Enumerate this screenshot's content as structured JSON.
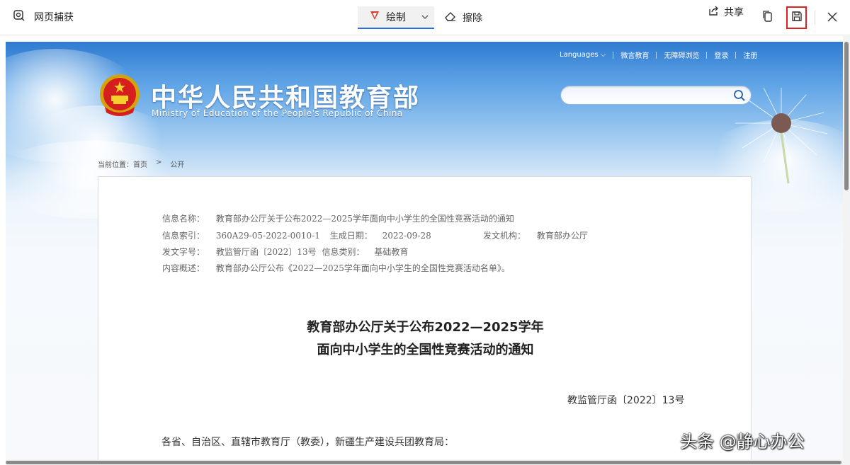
{
  "toolbar": {
    "app_label": "网页捕获",
    "draw_label": "绘制",
    "erase_label": "擦除",
    "share_label": "共享",
    "accent_color": "#2e6bd6",
    "save_highlight_color": "#e02020"
  },
  "site": {
    "links": {
      "languages": "Languages",
      "weibo": "微言教育",
      "accessible": "无障碍浏览",
      "login": "登录",
      "register": "注册"
    },
    "title_cn": "中华人民共和国教育部",
    "title_en": "Ministry of Education of the People's Republic of China",
    "search_placeholder": ""
  },
  "breadcrumb": {
    "prefix": "当前位置：",
    "home": "首页",
    "sep": ">",
    "current": "公开"
  },
  "document": {
    "meta": {
      "name_label": "信息名称：",
      "name_value": "教育部办公厅关于公布2022—2025学年面向中小学生的全国性竞赛活动的通知",
      "index_label": "信息索引：",
      "index_value": "360A29-05-2022-0010-1",
      "date_label": "生成日期：",
      "date_value": "2022-09-28",
      "org_label": "发文机构：",
      "org_value": "教育部办公厅",
      "docno_label": "发文字号：",
      "docno_value": "教监管厅函〔2022〕13号",
      "cat_label": "信息类别：",
      "cat_value": "基础教育",
      "summary_label": "内容概述：",
      "summary_value": "教育部办公厅公布《2022—2025学年面向中小学生的全国性竞赛活动名单》。"
    },
    "title_line1": "教育部办公厅关于公布2022—2025学年",
    "title_line2": "面向中小学生的全国性竞赛活动的通知",
    "doc_number": "教监管厅函〔2022〕13号",
    "addressee": "各省、自治区、直辖市教育厅（教委），新疆生产建设兵团教育局："
  },
  "watermark": "头条 @静心办公"
}
